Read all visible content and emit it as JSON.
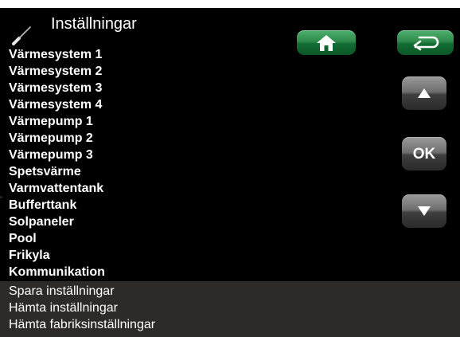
{
  "header": {
    "title": "Inställningar",
    "icon": "screwdriver-icon"
  },
  "menu": {
    "items": [
      "Värmesystem 1",
      "Värmesystem 2",
      "Värmesystem 3",
      "Värmesystem 4",
      "Värmepump 1",
      "Värmepump 2",
      "Värmepump 3",
      "Spetsvärme",
      "Varmvattentank",
      "Bufferttank",
      "Solpaneler",
      "Pool",
      "Frikyla",
      "Kommunikation"
    ]
  },
  "footer": {
    "items": [
      "Spara inställningar",
      "Hämta inställningar",
      "Hämta fabriksinställningar"
    ]
  },
  "buttons": {
    "home_icon": "home-icon",
    "back_icon": "back-arrow-icon",
    "up_icon": "arrow-up-icon",
    "ok_label": "OK",
    "down_icon": "arrow-down-icon"
  },
  "colors": {
    "background": "#000000",
    "footer_background": "#2e2a28",
    "text": "#ffffff",
    "green_button": "#1f7a3e",
    "grey_button": "#5a5a5a"
  }
}
